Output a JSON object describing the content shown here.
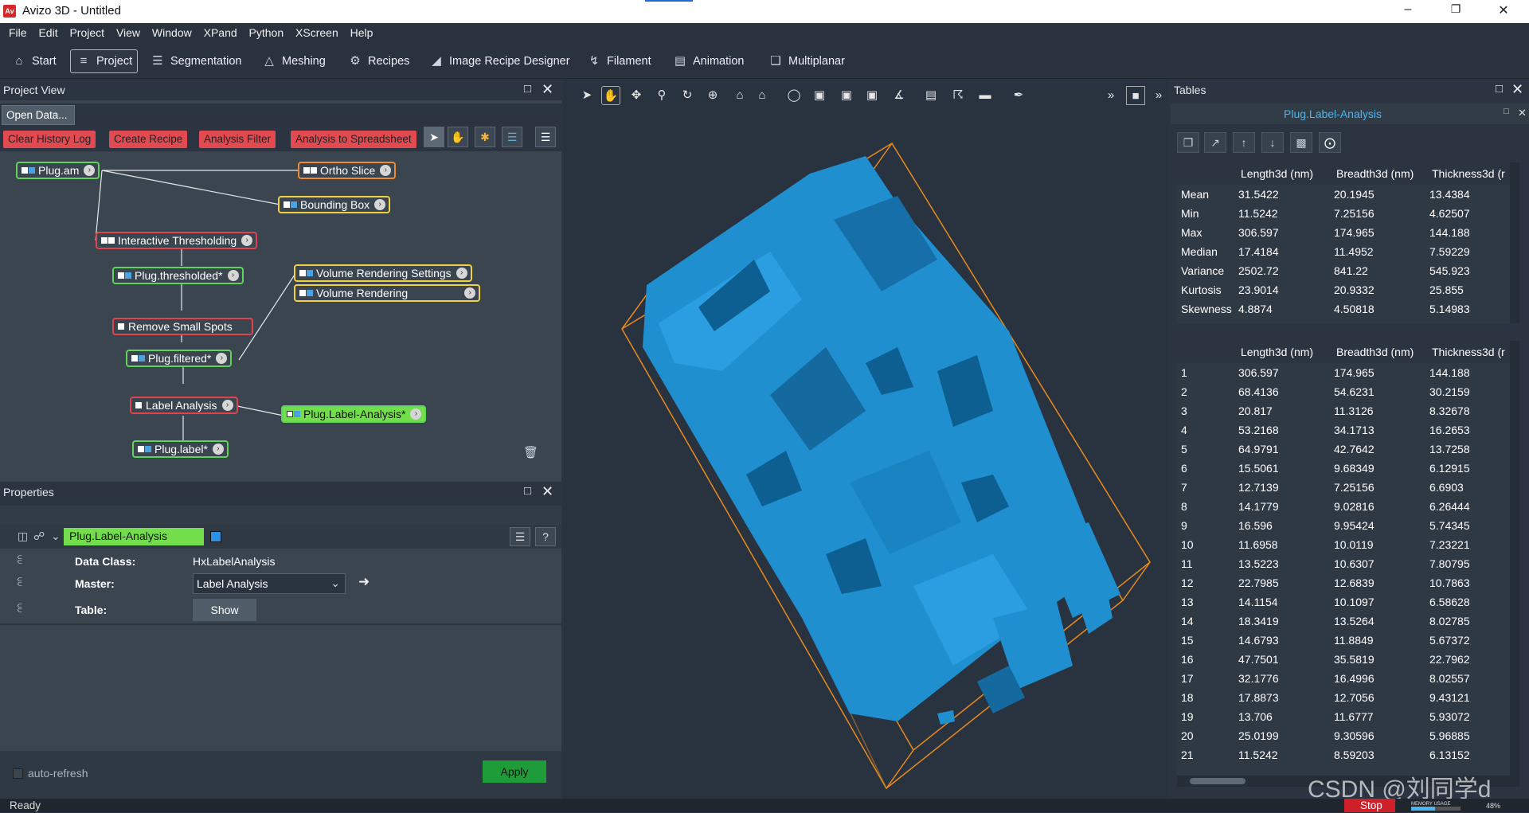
{
  "window": {
    "app_badge": "Av",
    "title": "Avizo 3D - Untitled"
  },
  "menu": [
    "File",
    "Edit",
    "Project",
    "View",
    "Window",
    "XPand",
    "Python",
    "XScreen",
    "Help"
  ],
  "toolbar": [
    {
      "label": "Start",
      "icon": "home-icon"
    },
    {
      "label": "Project",
      "icon": "project-icon"
    },
    {
      "label": "Segmentation",
      "icon": "layers-icon"
    },
    {
      "label": "Meshing",
      "icon": "mesh-icon"
    },
    {
      "label": "Recipes",
      "icon": "gears-icon"
    },
    {
      "label": "Image Recipe Designer",
      "icon": "recipe-designer-icon"
    },
    {
      "label": "Filament",
      "icon": "filament-icon"
    },
    {
      "label": "Animation",
      "icon": "clapper-icon"
    },
    {
      "label": "Multiplanar",
      "icon": "planes-icon"
    }
  ],
  "project_view": {
    "title": "Project View",
    "open_data": "Open Data...",
    "buttons": [
      "Clear History Log",
      "Create Recipe",
      "Analysis Filter",
      "Analysis to Spreadsheet"
    ],
    "nodes": {
      "plug_am": "Plug.am",
      "ortho": "Ortho Slice",
      "bbox": "Bounding Box",
      "thresholding": "Interactive Thresholding",
      "thresholded": "Plug.thresholded*",
      "vr_settings": "Volume Rendering Settings",
      "vr": "Volume Rendering",
      "remove_spots": "Remove Small Spots",
      "filtered": "Plug.filtered*",
      "label_analysis": "Label Analysis",
      "label_analysis_out": "Plug.Label-Analysis*",
      "label": "Plug.label*"
    }
  },
  "properties": {
    "title": "Properties",
    "module": "Plug.Label-Analysis",
    "rows": [
      {
        "label": "Data Class:",
        "value": "HxLabelAnalysis"
      },
      {
        "label": "Master:",
        "value": "Label Analysis"
      },
      {
        "label": "Table:",
        "value": "Show"
      }
    ],
    "auto_refresh": "auto-refresh",
    "apply": "Apply"
  },
  "status": {
    "text": "Ready",
    "stop": "Stop",
    "memory_label": "MEMORY USAGE",
    "memory_pct": "48%"
  },
  "tables": {
    "title": "Tables",
    "subtitle": "Plug.Label-Analysis",
    "columns": [
      "Length3d (nm)",
      "Breadth3d (nm)",
      "Thickness3d (r"
    ],
    "stats": [
      [
        "Mean",
        "31.5422",
        "20.1945",
        "13.4384"
      ],
      [
        "Min",
        "11.5242",
        "7.25156",
        "4.62507"
      ],
      [
        "Max",
        "306.597",
        "174.965",
        "144.188"
      ],
      [
        "Median",
        "17.4184",
        "11.4952",
        "7.59229"
      ],
      [
        "Variance",
        "2502.72",
        "841.22",
        "545.923"
      ],
      [
        "Kurtosis",
        "23.9014",
        "20.9332",
        "25.855"
      ],
      [
        "Skewness",
        "4.8874",
        "4.50818",
        "5.14983"
      ]
    ],
    "rows": [
      [
        "1",
        "306.597",
        "174.965",
        "144.188"
      ],
      [
        "2",
        "68.4136",
        "54.6231",
        "30.2159"
      ],
      [
        "3",
        "20.817",
        "11.3126",
        "8.32678"
      ],
      [
        "4",
        "53.2168",
        "34.1713",
        "16.2653"
      ],
      [
        "5",
        "64.9791",
        "42.7642",
        "13.7258"
      ],
      [
        "6",
        "15.5061",
        "9.68349",
        "6.12915"
      ],
      [
        "7",
        "12.7139",
        "7.25156",
        "6.6903"
      ],
      [
        "8",
        "14.1779",
        "9.02816",
        "6.26444"
      ],
      [
        "9",
        "16.596",
        "9.95424",
        "5.74345"
      ],
      [
        "10",
        "11.6958",
        "10.0119",
        "7.23221"
      ],
      [
        "11",
        "13.5223",
        "10.6307",
        "7.80795"
      ],
      [
        "12",
        "22.7985",
        "12.6839",
        "10.7863"
      ],
      [
        "13",
        "14.1154",
        "10.1097",
        "6.58628"
      ],
      [
        "14",
        "18.3419",
        "13.5264",
        "8.02785"
      ],
      [
        "15",
        "14.6793",
        "11.8849",
        "5.67372"
      ],
      [
        "16",
        "47.7501",
        "35.5819",
        "22.7962"
      ],
      [
        "17",
        "32.1776",
        "16.4996",
        "8.02557"
      ],
      [
        "18",
        "17.8873",
        "12.7056",
        "9.43121"
      ],
      [
        "19",
        "13.706",
        "11.6777",
        "5.93072"
      ],
      [
        "20",
        "25.0199",
        "9.30596",
        "5.96885"
      ],
      [
        "21",
        "11.5242",
        "8.59203",
        "6.13152"
      ]
    ]
  },
  "watermark": "CSDN @刘同学d",
  "colors": {
    "node_green": "#5fd35a",
    "node_orange": "#ef8a30",
    "node_yellow": "#f1d13d",
    "node_red": "#e0434b",
    "button_red": "#e24a52",
    "volume_blue": "#1f8fd0",
    "bbox_orange": "#e88a1e",
    "tables_accent": "#4cb4f0"
  }
}
